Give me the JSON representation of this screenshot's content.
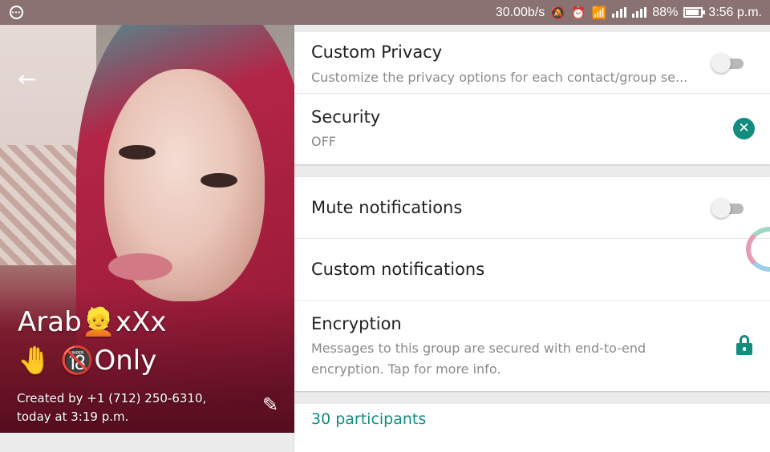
{
  "status_bar": {
    "speed": "30.00b/s",
    "battery_percent": "88%",
    "battery_level": 0.88,
    "time": "3:56 p.m.",
    "icons": [
      "notification-dots-icon",
      "mute-icon",
      "alarm-icon",
      "wifi-icon",
      "signal-icon",
      "signal-icon",
      "battery-icon"
    ]
  },
  "header": {
    "back_icon": "back-arrow-icon",
    "group_name_line1": "Arab👱xXx",
    "group_name_line2": "🤚  🔞Only",
    "created_line1": "Created by +1 (712) 250-6310,",
    "created_line2": "today at 3:19 p.m.",
    "edit_icon": "pencil-icon"
  },
  "privacy_card": {
    "custom_privacy": {
      "title": "Custom Privacy",
      "subtitle": "Customize the privacy options for each contact/group se...",
      "toggle_on": false
    },
    "security": {
      "title": "Security",
      "value": "OFF",
      "icon": "close-circle-icon"
    }
  },
  "notifications_card": {
    "mute": {
      "title": "Mute notifications",
      "toggle_on": false
    },
    "custom": {
      "title": "Custom notifications"
    },
    "encryption": {
      "title": "Encryption",
      "line1": "Messages to this group are secured with end-to-end",
      "line2": "encryption. Tap for more info.",
      "icon": "lock-icon"
    }
  },
  "participants": {
    "label": "30 participants"
  },
  "colors": {
    "accent": "#128c7e",
    "status_bar": "#8a7272",
    "text_primary": "#212121",
    "text_secondary": "#8a8a8a"
  }
}
